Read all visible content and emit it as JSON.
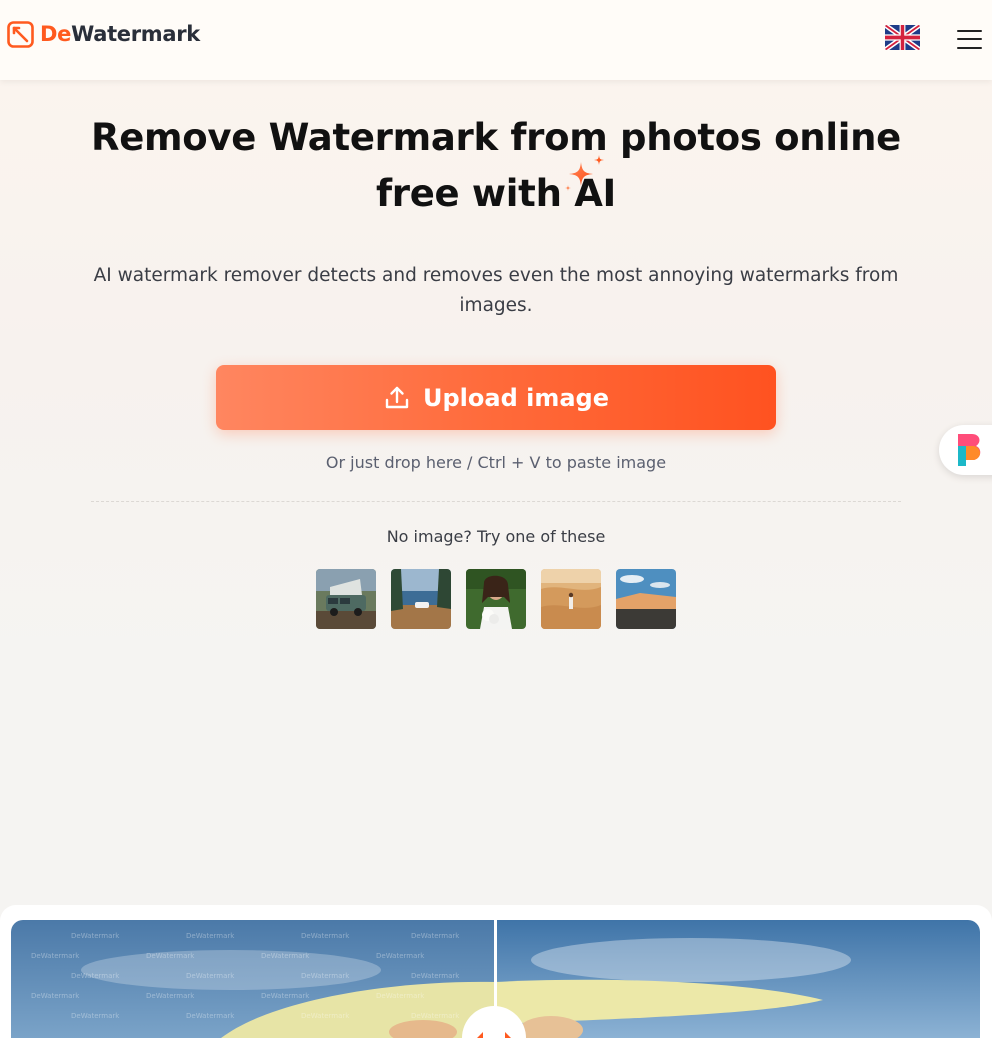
{
  "header": {
    "logo_prefix": "De",
    "logo_suffix": "Watermark",
    "language_flag": "uk-flag-icon",
    "menu_icon": "hamburger-menu-icon"
  },
  "hero": {
    "title": "Remove Watermark from photos online free with AI",
    "subtitle": "AI watermark remover detects and removes even the most annoying watermarks from images.",
    "upload_label": "Upload image",
    "upload_icon": "upload-icon",
    "drop_hint": "Or just drop here / Ctrl + V to paste image",
    "samples_label": "No image? Try one of these"
  },
  "samples": [
    {
      "name": "van-sample"
    },
    {
      "name": "lake-car-sample"
    },
    {
      "name": "woman-flowers-sample"
    },
    {
      "name": "desert-person-sample"
    },
    {
      "name": "dunes-sky-sample"
    }
  ],
  "colors": {
    "accent": "#ff5a1f",
    "button_start": "#ff8660",
    "button_end": "#ff5220"
  },
  "comparison": {
    "watermark_text": "DeWatermark",
    "slider_icon": "compare-arrows-icon"
  }
}
